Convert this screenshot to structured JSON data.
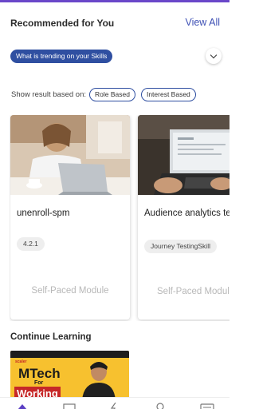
{
  "recommended": {
    "title": "Recommended for You",
    "view_all": "View All"
  },
  "trending_chip": "What is trending on your Skills",
  "filter": {
    "label": "Show result based on:",
    "options": [
      "Role Based",
      "Interest Based"
    ]
  },
  "cards": [
    {
      "title": "unenroll-spm",
      "tag": "4.2.1",
      "type": "Self-Paced Module",
      "image": "woman-laptop-image"
    },
    {
      "title": "Audience analytics testing",
      "tag": "Journey TestingSkill",
      "type": "Self-Paced Module",
      "image": "laptop-analytics-image"
    }
  ],
  "continue_learning": {
    "title": "Continue Learning",
    "video": {
      "logo_text": "scaler",
      "headline": "MTech",
      "sub": "For",
      "highlight": "Working"
    }
  },
  "bottom_nav": {
    "icons": [
      "home-icon",
      "mail-icon",
      "flash-icon",
      "profile-icon",
      "chat-icon"
    ]
  },
  "colors": {
    "accent": "#2f4fa1",
    "link": "#3f51b5",
    "top_bar": "#6a47c9",
    "thumb_bg": "#f7c12f"
  }
}
